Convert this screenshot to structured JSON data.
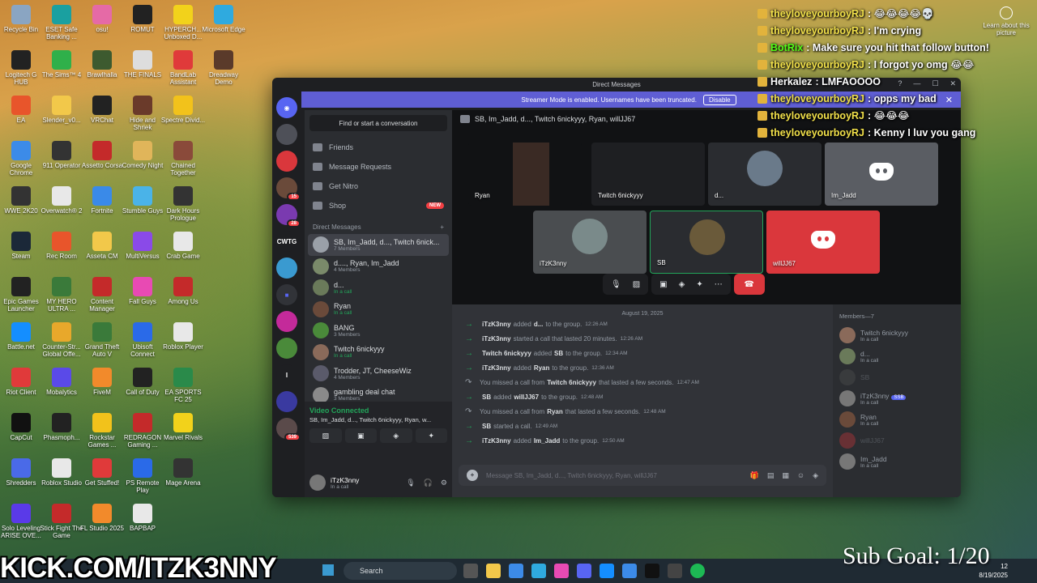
{
  "desktop_icons": [
    {
      "label": "Recycle Bin",
      "col": 0,
      "row": 0,
      "color": "#8aa5c2"
    },
    {
      "label": "ESET Safe Banking ...",
      "col": 1,
      "row": 0,
      "color": "#1aa0a0"
    },
    {
      "label": "osu!",
      "col": 2,
      "row": 0,
      "color": "#e56aa6"
    },
    {
      "label": "ROMUT",
      "col": 3,
      "row": 0,
      "color": "#222"
    },
    {
      "label": "HYPERCH... Unboxed D...",
      "col": 4,
      "row": 0,
      "color": "#f2d21b"
    },
    {
      "label": "Microsoft Edge",
      "col": 5,
      "row": 0,
      "color": "#2faadf"
    },
    {
      "label": "Logitech G HUB",
      "col": 0,
      "row": 1,
      "color": "#222"
    },
    {
      "label": "The Sims™ 4",
      "col": 1,
      "row": 1,
      "color": "#2fb04a"
    },
    {
      "label": "Brawlhalla",
      "col": 2,
      "row": 1,
      "color": "#3d5a2f"
    },
    {
      "label": "THE FINALS",
      "col": 3,
      "row": 1,
      "color": "#ddd"
    },
    {
      "label": "BandLab Assistant",
      "col": 4,
      "row": 1,
      "color": "#e03a3a"
    },
    {
      "label": "Dreadway Demo",
      "col": 5,
      "row": 1,
      "color": "#5a3a2a"
    },
    {
      "label": "EA",
      "col": 0,
      "row": 2,
      "color": "#e8552b"
    },
    {
      "label": "Slender_v0...",
      "col": 1,
      "row": 2,
      "color": "#f2c84a"
    },
    {
      "label": "VRChat",
      "col": 2,
      "row": 2,
      "color": "#222"
    },
    {
      "label": "Hide and Shriek",
      "col": 3,
      "row": 2,
      "color": "#6a3a2a"
    },
    {
      "label": "Spectre Divid...",
      "col": 4,
      "row": 2,
      "color": "#f2c21b"
    },
    {
      "label": "Google Chrome",
      "col": 0,
      "row": 3,
      "color": "#3c8be8"
    },
    {
      "label": "911 Operator",
      "col": 1,
      "row": 3,
      "color": "#333"
    },
    {
      "label": "Assetto Corsa",
      "col": 2,
      "row": 3,
      "color": "#c42a2a"
    },
    {
      "label": "Comedy Night",
      "col": 3,
      "row": 3,
      "color": "#e0b55a"
    },
    {
      "label": "Chained Together",
      "col": 4,
      "row": 3,
      "color": "#8a4a3a"
    },
    {
      "label": "WWE 2K20",
      "col": 0,
      "row": 4,
      "color": "#333"
    },
    {
      "label": "Overwatch® 2",
      "col": 1,
      "row": 4,
      "color": "#e8e8e8"
    },
    {
      "label": "Fortnite",
      "col": 2,
      "row": 4,
      "color": "#3a8ae8"
    },
    {
      "label": "Stumble Guys",
      "col": 3,
      "row": 4,
      "color": "#4ab3e8"
    },
    {
      "label": "Dark Hours Prologue",
      "col": 4,
      "row": 4,
      "color": "#333"
    },
    {
      "label": "Steam",
      "col": 0,
      "row": 5,
      "color": "#1b2838"
    },
    {
      "label": "Rec Room",
      "col": 1,
      "row": 5,
      "color": "#e8552b"
    },
    {
      "label": "Asseta CM",
      "col": 2,
      "row": 5,
      "color": "#f2c84a"
    },
    {
      "label": "MultiVersus",
      "col": 3,
      "row": 5,
      "color": "#8a4ae8"
    },
    {
      "label": "Crab Game",
      "col": 4,
      "row": 5,
      "color": "#e8e8e8"
    },
    {
      "label": "Epic Games Launcher",
      "col": 0,
      "row": 6,
      "color": "#222"
    },
    {
      "label": "MY HERO ULTRA ...",
      "col": 1,
      "row": 6,
      "color": "#3a7a3a"
    },
    {
      "label": "Content Manager",
      "col": 2,
      "row": 6,
      "color": "#c42a2a"
    },
    {
      "label": "Fall Guys",
      "col": 3,
      "row": 6,
      "color": "#e84ab3"
    },
    {
      "label": "Among Us",
      "col": 4,
      "row": 6,
      "color": "#c42a2a"
    },
    {
      "label": "Battle.net",
      "col": 0,
      "row": 7,
      "color": "#148eff"
    },
    {
      "label": "Counter-Str... Global Offe...",
      "col": 1,
      "row": 7,
      "color": "#e8a82b"
    },
    {
      "label": "Grand Theft Auto V",
      "col": 2,
      "row": 7,
      "color": "#3a7a3a"
    },
    {
      "label": "Ubisoft Connect",
      "col": 3,
      "row": 7,
      "color": "#2a6ae8"
    },
    {
      "label": "Roblox Player",
      "col": 4,
      "row": 7,
      "color": "#e8e8e8"
    },
    {
      "label": "Riot Client",
      "col": 0,
      "row": 8,
      "color": "#e03a3a"
    },
    {
      "label": "Mobalytics",
      "col": 1,
      "row": 8,
      "color": "#5a4ae8"
    },
    {
      "label": "FiveM",
      "col": 2,
      "row": 8,
      "color": "#f28a2b"
    },
    {
      "label": "Call of Duty",
      "col": 3,
      "row": 8,
      "color": "#222"
    },
    {
      "label": "EA SPORTS FC 25",
      "col": 4,
      "row": 8,
      "color": "#2a8a4a"
    },
    {
      "label": "CapCut",
      "col": 0,
      "row": 9,
      "color": "#111"
    },
    {
      "label": "Phasmoph...",
      "col": 1,
      "row": 9,
      "color": "#222"
    },
    {
      "label": "Rockstar Games ...",
      "col": 2,
      "row": 9,
      "color": "#f2c21b"
    },
    {
      "label": "REDRAGON Gaming ...",
      "col": 3,
      "row": 9,
      "color": "#c42a2a"
    },
    {
      "label": "Marvel Rivals",
      "col": 4,
      "row": 9,
      "color": "#f2d21b"
    },
    {
      "label": "Shredders",
      "col": 0,
      "row": 10,
      "color": "#4a6ae8"
    },
    {
      "label": "Roblox Studio",
      "col": 1,
      "row": 10,
      "color": "#e8e8e8"
    },
    {
      "label": "Get Stuffed!",
      "col": 2,
      "row": 10,
      "color": "#e03a3a"
    },
    {
      "label": "PS Remote Play",
      "col": 3,
      "row": 10,
      "color": "#2a6ae8"
    },
    {
      "label": "Mage Arena",
      "col": 4,
      "row": 10,
      "color": "#333"
    },
    {
      "label": "Solo Leveling ARISE OVE...",
      "col": 0,
      "row": 11,
      "color": "#5a3ae8"
    },
    {
      "label": "Stick Fight The Game",
      "col": 1,
      "row": 11,
      "color": "#c42a2a"
    },
    {
      "label": "FL Studio 2025",
      "col": 2,
      "row": 11,
      "color": "#f28a2b"
    },
    {
      "label": "BAPBAP",
      "col": 3,
      "row": 11,
      "color": "#e8e8e8"
    }
  ],
  "chat": [
    {
      "user": "theyloveyourboyRJ",
      "msg": ": 😂😂😂😂💀",
      "style": "n"
    },
    {
      "user": "theyloveyourboyRJ",
      "msg": ": I'm crying",
      "style": "n"
    },
    {
      "user": "BotRix",
      "msg": ": Make sure you hit that follow button!",
      "style": "n g"
    },
    {
      "user": "theyloveyourboyRJ",
      "msg": ": I forgot yo omg 😂😂",
      "style": "n"
    },
    {
      "user": "Herkalez",
      "msg": ": LMFAOOOO",
      "style": "n c"
    },
    {
      "user": "theyloveyourboyRJ",
      "msg": ": opps my bad",
      "style": "n"
    },
    {
      "user": "theyloveyourboyRJ",
      "msg": ": 😂😂😂",
      "style": "n"
    },
    {
      "user": "theyloveyourboyRJ",
      "msg": ": Kenny I luv you gang",
      "style": "n"
    }
  ],
  "learn": "Learn about this picture",
  "window": {
    "title": "Direct Messages",
    "notice": "Streamer Mode is enabled. Usernames have been truncated.",
    "disable": "Disable",
    "search_placeholder": "Find or start a conversation",
    "nav": [
      {
        "label": "Friends"
      },
      {
        "label": "Message Requests"
      },
      {
        "label": "Get Nitro"
      },
      {
        "label": "Shop",
        "badge": "NEW"
      }
    ],
    "dm_header": "Direct Messages",
    "dms": [
      {
        "title": "SB, Im_Jadd, d..., Twitch 6nick...",
        "sub": "7 Members",
        "active": true,
        "color": "#9aa0a8"
      },
      {
        "title": "d...., Ryan, Im_Jadd",
        "sub": "4 Members",
        "color": "#7a8a6a"
      },
      {
        "title": "d...",
        "sub": "In a call",
        "green": true,
        "color": "#6a7a5a"
      },
      {
        "title": "Ryan",
        "sub": "In a call",
        "green": true,
        "color": "#6a4a3a"
      },
      {
        "title": "BANG",
        "sub": "3 Members",
        "color": "#4a8a3a"
      },
      {
        "title": "Twitch 6nickyyy",
        "sub": "In a call",
        "green": true,
        "color": "#8a6a5a"
      },
      {
        "title": "Trodder, JT, CheeseWiz",
        "sub": "4 Members",
        "color": "#5a5a6a"
      },
      {
        "title": "gambling deal chat",
        "sub": "3 Members",
        "color": "#8a8a8a"
      }
    ],
    "vc_title": "Video Connected",
    "vc_sub": "SB, Im_Jadd, d..., Twitch 6nickyyy, Ryan, w...",
    "user_name": "iTzK3nny",
    "user_status": "In a call",
    "channel_header": "SB, Im_Jadd, d..., Twitch 6nickyyy, Ryan, willJJ67",
    "tiles": [
      {
        "label": "Ryan"
      },
      {
        "label": "Twitch 6nickyyy"
      },
      {
        "label": "d..."
      },
      {
        "label": "Im_Jadd"
      },
      {
        "label": "iTzK3nny"
      },
      {
        "label": "SB"
      },
      {
        "label": "willJJ67"
      }
    ],
    "date": "August 19, 2025",
    "messages": [
      {
        "a": "iTzK3nny",
        "t1": "added",
        "b": "d...",
        "t2": "to the group.",
        "time": "12:26 AM"
      },
      {
        "a": "iTzK3nny",
        "t1": "started a call that lasted 20 minutes.",
        "b": "",
        "t2": "",
        "time": "12:26 AM"
      },
      {
        "a": "Twitch 6nickyyy",
        "t1": "added",
        "b": "SB",
        "t2": "to the group.",
        "time": "12:34 AM"
      },
      {
        "a": "iTzK3nny",
        "t1": "added",
        "b": "Ryan",
        "t2": "to the group.",
        "time": "12:36 AM"
      },
      {
        "a": "",
        "t1": "You missed a call from",
        "b": "Twitch 6nickyyy",
        "t2": "that lasted a few seconds.",
        "time": "12:47 AM",
        "miss": true
      },
      {
        "a": "SB",
        "t1": "added",
        "b": "willJJ67",
        "t2": "to the group.",
        "time": "12:48 AM"
      },
      {
        "a": "",
        "t1": "You missed a call from",
        "b": "Ryan",
        "t2": "that lasted a few seconds.",
        "time": "12:48 AM",
        "miss": true
      },
      {
        "a": "SB",
        "t1": "started a call.",
        "b": "",
        "t2": "",
        "time": "12:49 AM"
      },
      {
        "a": "iTzK3nny",
        "t1": "added",
        "b": "Im_Jadd",
        "t2": "to the group.",
        "time": "12:50 AM"
      }
    ],
    "composer_placeholder": "Message SB, Im_Jadd, d..., Twitch 6nickyyy, Ryan, willJJ67",
    "members_header": "Members—7",
    "members": [
      {
        "name": "Twitch 6nickyyy",
        "sub": "In a call",
        "color": "#8a6a5a"
      },
      {
        "name": "d...",
        "sub": "In a call",
        "color": "#6a7a5a"
      },
      {
        "name": "SB",
        "sub": "",
        "dim": true,
        "color": "#555"
      },
      {
        "name": "iTzK3nny",
        "sub": "In a call",
        "tag": "SSB",
        "color": "#777"
      },
      {
        "name": "Ryan",
        "sub": "In a call",
        "color": "#6a4a3a"
      },
      {
        "name": "willJJ67",
        "sub": "",
        "dim": true,
        "color": "#da373c"
      },
      {
        "name": "Im_Jadd",
        "sub": "In a call",
        "color": "#777"
      }
    ]
  },
  "taskbar": {
    "search": "Search",
    "time": "12",
    "date": "8/19/2025"
  },
  "overlay": {
    "kick": "KICK.COM/ITZK3NNY",
    "goal": "Sub Goal: 1/20"
  }
}
